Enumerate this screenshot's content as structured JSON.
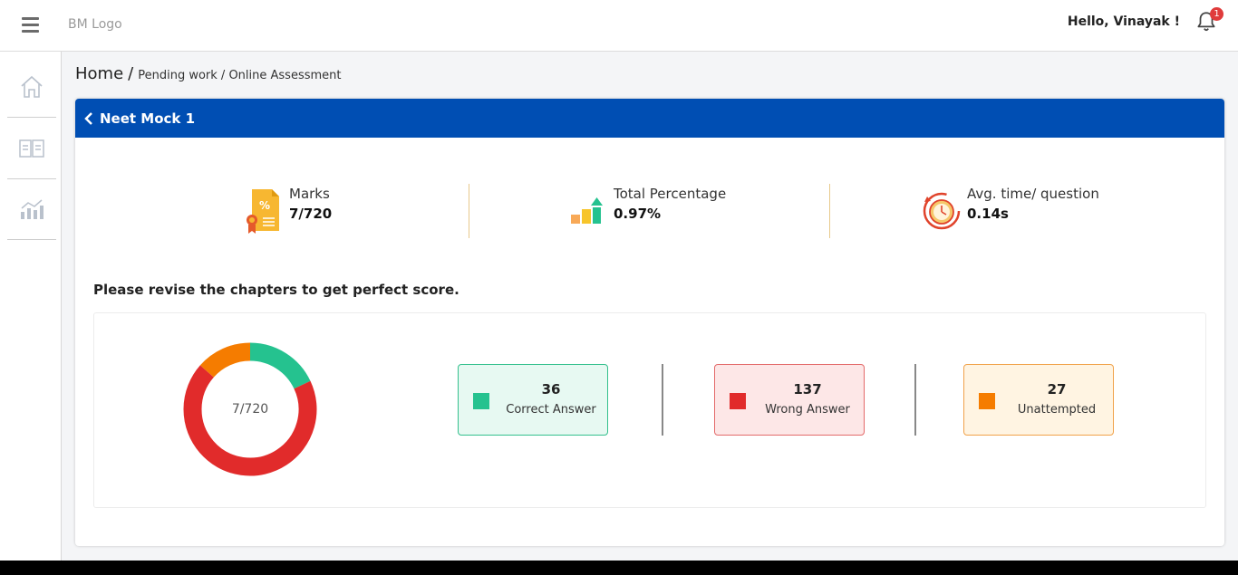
{
  "header": {
    "logo": "BM Logo",
    "greeting": "Hello, Vinayak !",
    "notification_count": "1"
  },
  "breadcrumb": {
    "home": "Home",
    "separator": "/",
    "rest": "Pending work / Online Assessment"
  },
  "assessment": {
    "title": "Neet Mock 1",
    "stats": [
      {
        "label": "Marks",
        "value": "7/720",
        "icon": "marks-certificate-icon"
      },
      {
        "label": "Total Percentage",
        "value": "0.97%",
        "icon": "bar-growth-icon"
      },
      {
        "label": "Avg. time/ question",
        "value": "0.14s",
        "icon": "stopwatch-icon"
      }
    ],
    "revise_message": "Please revise the chapters to get perfect score.",
    "donut_label": "7/720",
    "breakdown": [
      {
        "count": "36",
        "label": "Correct Answer",
        "color": "#25c28f",
        "bg": "#e7f9f2",
        "border": "#34c08d"
      },
      {
        "count": "137",
        "label": "Wrong Answer",
        "color": "#e12b2b",
        "bg": "#fde7e7",
        "border": "#e36a6a"
      },
      {
        "count": "27",
        "label": "Unattempted",
        "color": "#f57c00",
        "bg": "#fff4e2",
        "border": "#f0a24a"
      }
    ]
  },
  "colors": {
    "header_blue": "#004eb3",
    "correct": "#25c28f",
    "wrong": "#e12b2b",
    "unattempted": "#f57c00"
  }
}
